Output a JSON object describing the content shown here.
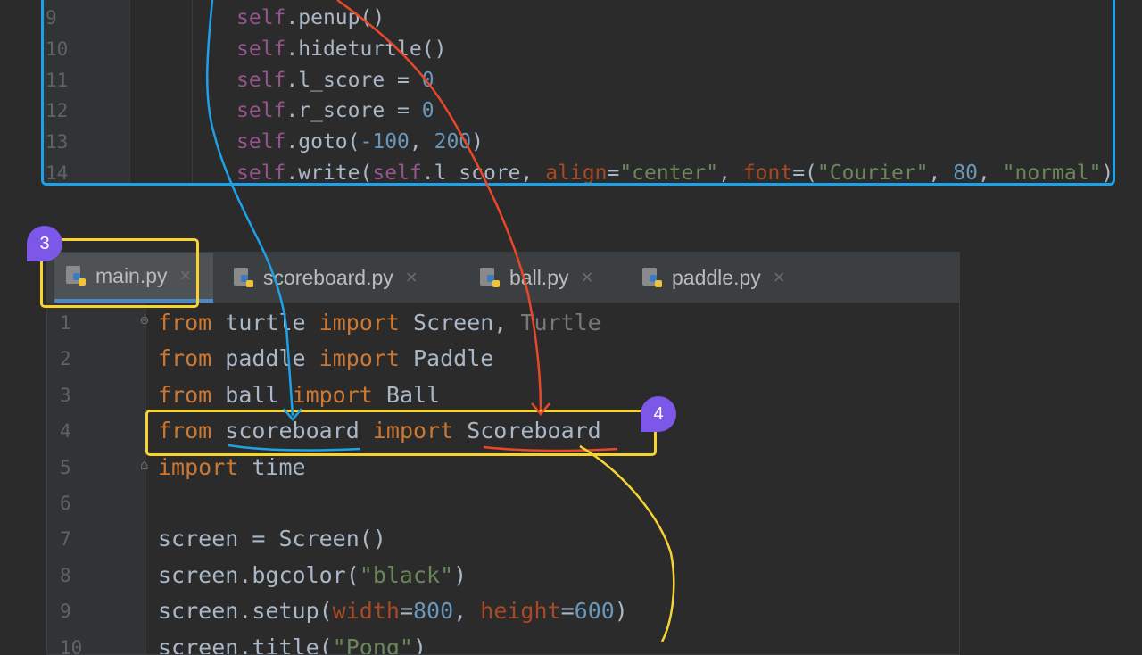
{
  "top_editor": {
    "lines": [
      {
        "num": "9",
        "parts": [
          [
            "slf",
            "self"
          ],
          [
            "",
            "."
          ],
          [
            "",
            "penup"
          ],
          [
            "",
            "()"
          ]
        ]
      },
      {
        "num": "10",
        "parts": [
          [
            "slf",
            "self"
          ],
          [
            "",
            "."
          ],
          [
            "",
            "hideturtle"
          ],
          [
            "",
            "()"
          ]
        ]
      },
      {
        "num": "11",
        "parts": [
          [
            "slf",
            "self"
          ],
          [
            "",
            "."
          ],
          [
            "",
            "l_score = "
          ],
          [
            "num",
            "0"
          ]
        ]
      },
      {
        "num": "12",
        "parts": [
          [
            "slf",
            "self"
          ],
          [
            "",
            "."
          ],
          [
            "",
            "r_score = "
          ],
          [
            "num",
            "0"
          ]
        ]
      },
      {
        "num": "13",
        "parts": [
          [
            "slf",
            "self"
          ],
          [
            "",
            "."
          ],
          [
            "",
            "goto("
          ],
          [
            "num",
            "-100"
          ],
          [
            "",
            ", "
          ],
          [
            "num",
            "200"
          ],
          [
            "",
            ")"
          ]
        ]
      },
      {
        "num": "14",
        "parts": [
          [
            "slf",
            "self"
          ],
          [
            "",
            "."
          ],
          [
            "",
            "write("
          ],
          [
            "slf",
            "self"
          ],
          [
            "",
            ".l_score, "
          ],
          [
            "par",
            "align"
          ],
          [
            "",
            "="
          ],
          [
            "str",
            "\"center\""
          ],
          [
            "",
            ", "
          ],
          [
            "par",
            "font"
          ],
          [
            "",
            "=("
          ],
          [
            "str",
            "\"Courier\""
          ],
          [
            "",
            ", "
          ],
          [
            "num",
            "80"
          ],
          [
            "",
            ", "
          ],
          [
            "str",
            "\"normal\""
          ],
          [
            "",
            "))"
          ]
        ]
      }
    ]
  },
  "tabs": [
    {
      "label": "main.py",
      "close": "×"
    },
    {
      "label": "scoreboard.py",
      "close": "×"
    },
    {
      "label": "ball.py",
      "close": "×"
    },
    {
      "label": "paddle.py",
      "close": "×"
    }
  ],
  "bottom_editor": {
    "lines": [
      {
        "num": "1",
        "parts": [
          [
            "kw",
            "from"
          ],
          [
            "",
            " turtle "
          ],
          [
            "kw",
            "import"
          ],
          [
            "",
            " Screen, "
          ],
          [
            "dim",
            "Turtle"
          ]
        ]
      },
      {
        "num": "2",
        "parts": [
          [
            "kw",
            "from"
          ],
          [
            "",
            " paddle "
          ],
          [
            "kw",
            "import"
          ],
          [
            "",
            " Paddle"
          ]
        ]
      },
      {
        "num": "3",
        "parts": [
          [
            "kw",
            "from"
          ],
          [
            "",
            " ball "
          ],
          [
            "kw",
            "import"
          ],
          [
            "",
            " Ball"
          ]
        ]
      },
      {
        "num": "4",
        "parts": [
          [
            "kw",
            "from"
          ],
          [
            "",
            " scoreboard "
          ],
          [
            "kw",
            "import"
          ],
          [
            "",
            " Scoreboard"
          ]
        ]
      },
      {
        "num": "5",
        "parts": [
          [
            "kw",
            "import"
          ],
          [
            "",
            " time"
          ]
        ]
      },
      {
        "num": "6",
        "parts": []
      },
      {
        "num": "7",
        "parts": [
          [
            "",
            "screen = Screen()"
          ]
        ]
      },
      {
        "num": "8",
        "parts": [
          [
            "",
            "screen.bgcolor("
          ],
          [
            "str",
            "\"black\""
          ],
          [
            "",
            ")"
          ]
        ]
      },
      {
        "num": "9",
        "parts": [
          [
            "",
            "screen.setup("
          ],
          [
            "par",
            "width"
          ],
          [
            "",
            "="
          ],
          [
            "num",
            "800"
          ],
          [
            "",
            ", "
          ],
          [
            "par",
            "height"
          ],
          [
            "",
            "="
          ],
          [
            "num",
            "600"
          ],
          [
            "",
            ")"
          ]
        ]
      },
      {
        "num": "10",
        "parts": [
          [
            "",
            "screen.title("
          ],
          [
            "str",
            "\"Pong\""
          ],
          [
            "",
            ")"
          ]
        ]
      }
    ]
  },
  "badges": {
    "first": "3",
    "second": "4"
  },
  "colors": {
    "annotation_blue": "#1ea1e6",
    "annotation_yellow": "#f7d332",
    "annotation_red": "#e8472a",
    "badge_purple": "#7c57e8"
  }
}
